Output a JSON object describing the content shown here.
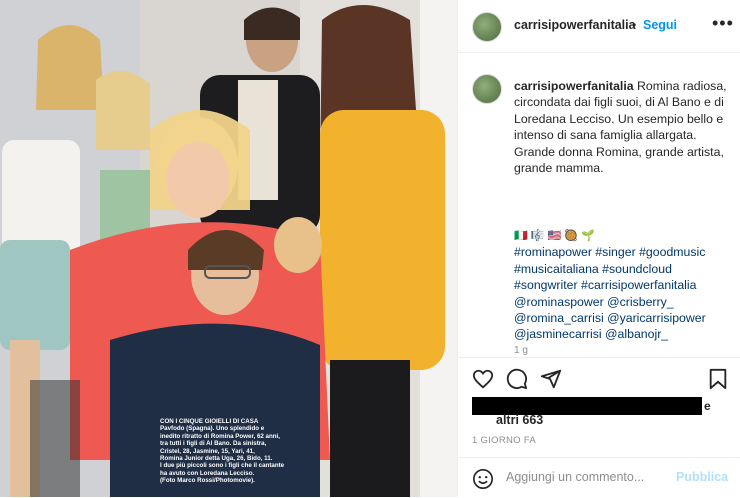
{
  "photo": {
    "caption_lines": [
      "CON I CINQUE GIOIELLI DI CASA",
      "Pavfodo (Spagna). Uno splendido e",
      "inedito ritratto di Romina Power, 62 anni,",
      "tra tutti i figli di Al Bano. Da sinistra,",
      "Cristel, 28, Jasmine, 15, Yari, 41,",
      "Romina Junior detta Uga, 26, Bido, 11.",
      "I due più piccoli sono i figli che il cantante",
      "ha avuto con Loredana Lecciso.",
      "(Foto Marco Rossi/Photomovie)."
    ]
  },
  "header": {
    "username": "carrisipowerfanitalia",
    "separator": "•",
    "follow_label": "Segui",
    "more_icon": "more-horizontal-icon"
  },
  "comment": {
    "username": "carrisipowerfanitalia",
    "text": "Romina radiosa, circondata dai figli suoi, di Al Bano e di Loredana Lecciso. Un esempio bello e intenso di sana famiglia allargata. Grande donna Romina, grande artista, grande mamma."
  },
  "tags": {
    "emoji_line": "🇮🇹 🎼 🇺🇸 🥘 🌱",
    "lines": [
      "#rominapower #singer #goodmusic",
      "#musicaitaliana #soundcloud",
      "#songwriter #carrisipowerfanitalia",
      "@rominaspower @crisberry_",
      "@romina_carrisi @yaricarrisipower",
      "@jasminecarrisi @albanojr_"
    ]
  },
  "comment_time": "1 g",
  "actions": {
    "like_icon": "heart-icon",
    "comment_icon": "comment-bubble-icon",
    "share_icon": "paper-plane-icon",
    "save_icon": "bookmark-icon"
  },
  "likes": {
    "suffix_letter": "e",
    "others": "altri 663"
  },
  "date": "1 GIORNO FA",
  "add_comment": {
    "placeholder": "Aggiungi un commento...",
    "publish_label": "Pubblica",
    "emoji_icon": "smiley-icon"
  }
}
